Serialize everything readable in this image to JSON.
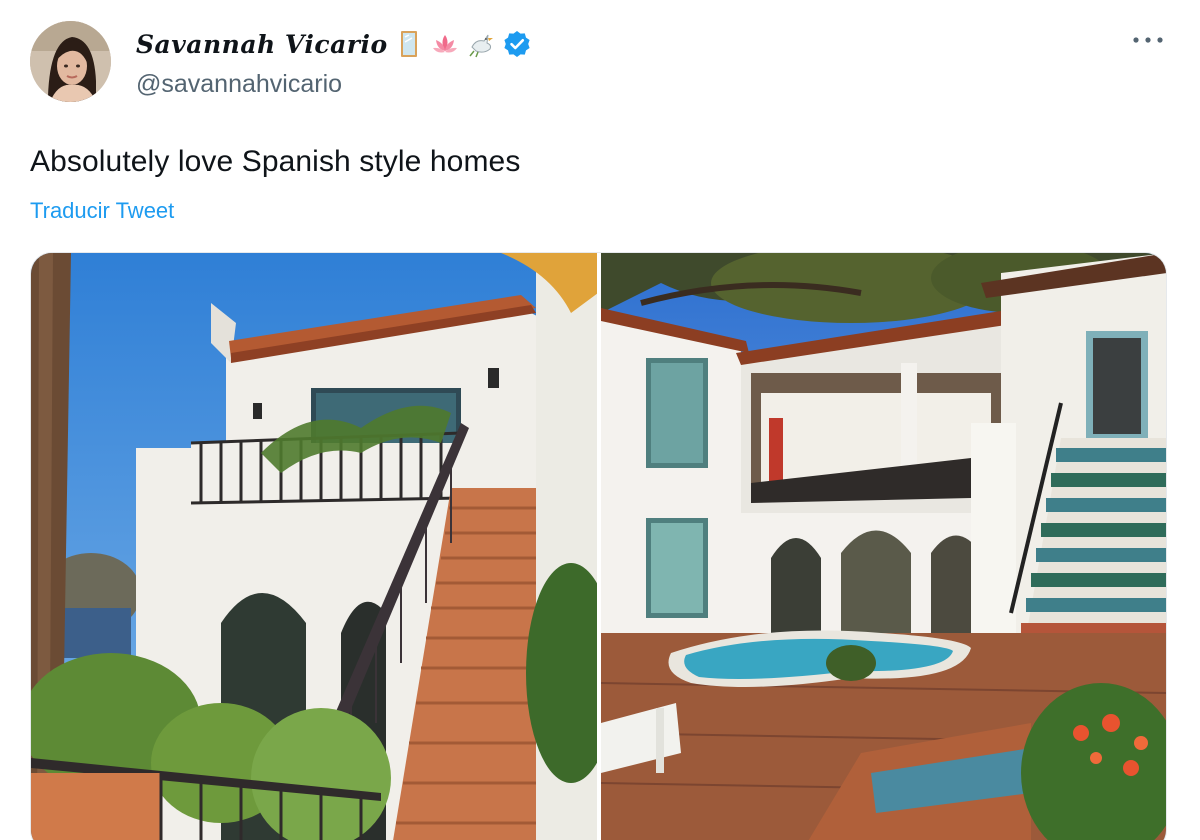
{
  "user": {
    "display_name": "Savannah Vicario",
    "handle": "@savannahvicario",
    "name_emojis": [
      "mirror-icon",
      "lotus-icon",
      "dove-icon",
      "verified-badge-icon"
    ]
  },
  "tweet": {
    "text": "Absolutely love Spanish style homes",
    "translate_label": "Traducir Tweet"
  },
  "media": {
    "photos": [
      "spanish-house-exterior-photo",
      "spanish-courtyard-pool-photo"
    ]
  },
  "colors": {
    "link": "#1d9bf0",
    "secondary_text": "#536471",
    "verified": "#1d9bf0"
  }
}
